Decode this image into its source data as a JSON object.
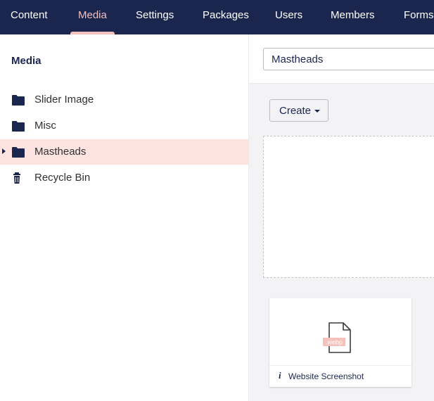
{
  "nav": {
    "items": [
      {
        "label": "Content"
      },
      {
        "label": "Media",
        "active": true
      },
      {
        "label": "Settings"
      },
      {
        "label": "Packages"
      },
      {
        "label": "Users"
      },
      {
        "label": "Members"
      },
      {
        "label": "Forms"
      }
    ]
  },
  "sidebar": {
    "title": "Media",
    "items": [
      {
        "label": "Slider Image",
        "icon": "folder-icon"
      },
      {
        "label": "Misc",
        "icon": "folder-icon"
      },
      {
        "label": "Mastheads",
        "icon": "folder-icon",
        "selected": true
      },
      {
        "label": "Recycle Bin",
        "icon": "trash-icon"
      }
    ]
  },
  "editor": {
    "name_value": "Mastheads",
    "create_label": "Create"
  },
  "media": {
    "items": [
      {
        "name": "Website Screenshot",
        "extension": ".webp"
      }
    ]
  },
  "colors": {
    "nav_background": "#1b264f",
    "nav_active": "#f5c1bc",
    "selected_row": "#fde4e1",
    "ext_badge": "#f5c1bc"
  }
}
